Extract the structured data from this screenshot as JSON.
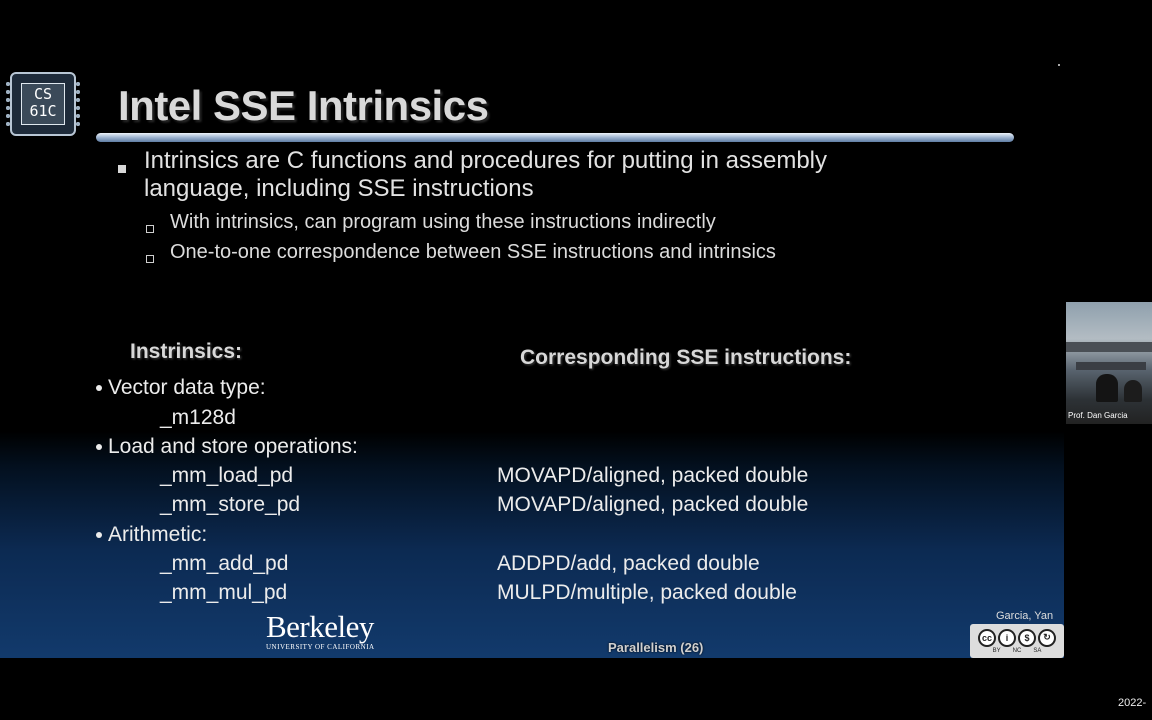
{
  "logo": {
    "line1": "CS",
    "line2": "61C"
  },
  "slide": {
    "title": "Intel SSE Intrinsics",
    "bullet1": "Intrinsics are C functions and procedures for putting in assembly language, including SSE instructions",
    "sub_bullets": [
      "With intrinsics, can program using these instructions indirectly",
      "One-to-one correspondence between SSE instructions and intrinsics"
    ],
    "left_header": "Instrinsics:",
    "right_header": "Corresponding SSE instructions:",
    "groups": [
      {
        "label": "Vector data type:",
        "items": [
          {
            "intrinsic": "_m128d",
            "instruction": ""
          }
        ]
      },
      {
        "label": "Load and store operations:",
        "items": [
          {
            "intrinsic": "_mm_load_pd",
            "instruction": "MOVAPD/aligned, packed double"
          },
          {
            "intrinsic": "_mm_store_pd",
            "instruction": "MOVAPD/aligned, packed double"
          }
        ]
      },
      {
        "label": "Arithmetic:",
        "items": [
          {
            "intrinsic": "_mm_add_pd",
            "instruction": "ADDPD/add, packed double"
          },
          {
            "intrinsic": "_mm_mul_pd",
            "instruction": "MULPD/multiple, packed double"
          }
        ]
      }
    ],
    "university_name": "Berkeley",
    "university_sub": "UNIVERSITY OF CALIFORNIA",
    "footer": "Parallelism (26)",
    "credit": "Garcia, Yan",
    "license_icons": [
      "cc",
      "by",
      "nc",
      "sa"
    ],
    "license_labels": [
      "BY",
      "NC",
      "SA"
    ]
  },
  "webcam": {
    "label": "Prof. Dan Garcia"
  },
  "clock": {
    "date": "2022-"
  }
}
